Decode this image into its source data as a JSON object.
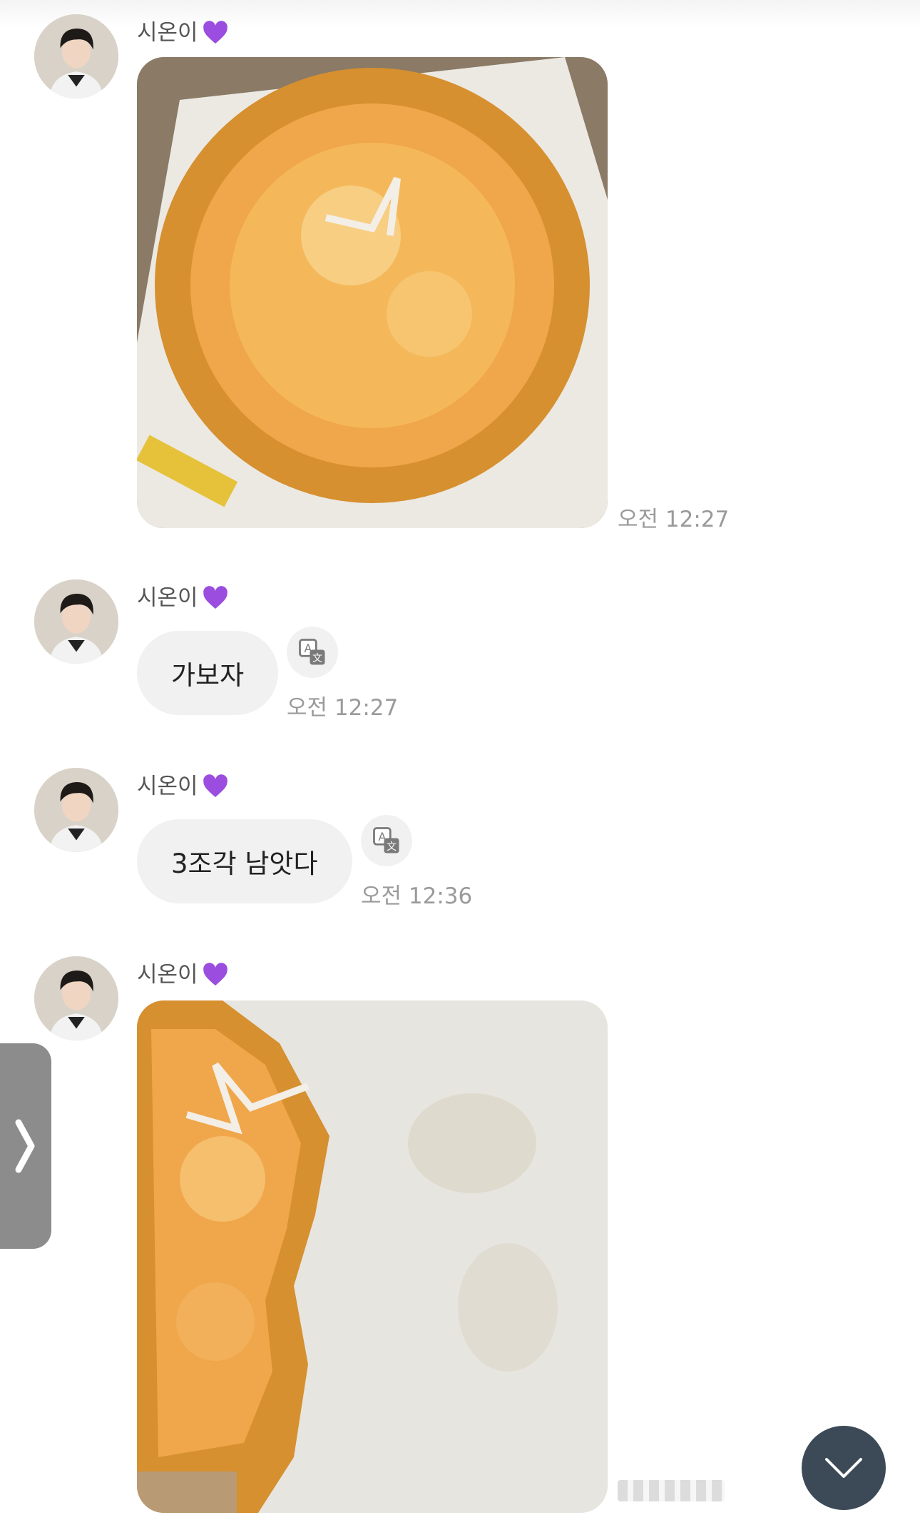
{
  "messages": [
    {
      "sender": "시온이",
      "type": "image",
      "time": "오전 12:27"
    },
    {
      "sender": "시온이",
      "type": "text",
      "text": "가보자",
      "time": "오전 12:27"
    },
    {
      "sender": "시온이",
      "type": "text",
      "text": "3조각 남앗다",
      "time": "오전 12:36"
    },
    {
      "sender": "시온이",
      "type": "image",
      "time": ""
    }
  ],
  "icons": {
    "heart": "purple-heart-icon",
    "translate": "translate-icon",
    "side_tab": "chevron-right-icon",
    "scroll_down": "chevron-down-icon"
  },
  "colors": {
    "heart": "#9b4de0",
    "bubble": "#f1f1f1",
    "scroll_button": "#3c4a57",
    "side_tab": "#8c8c8c"
  }
}
